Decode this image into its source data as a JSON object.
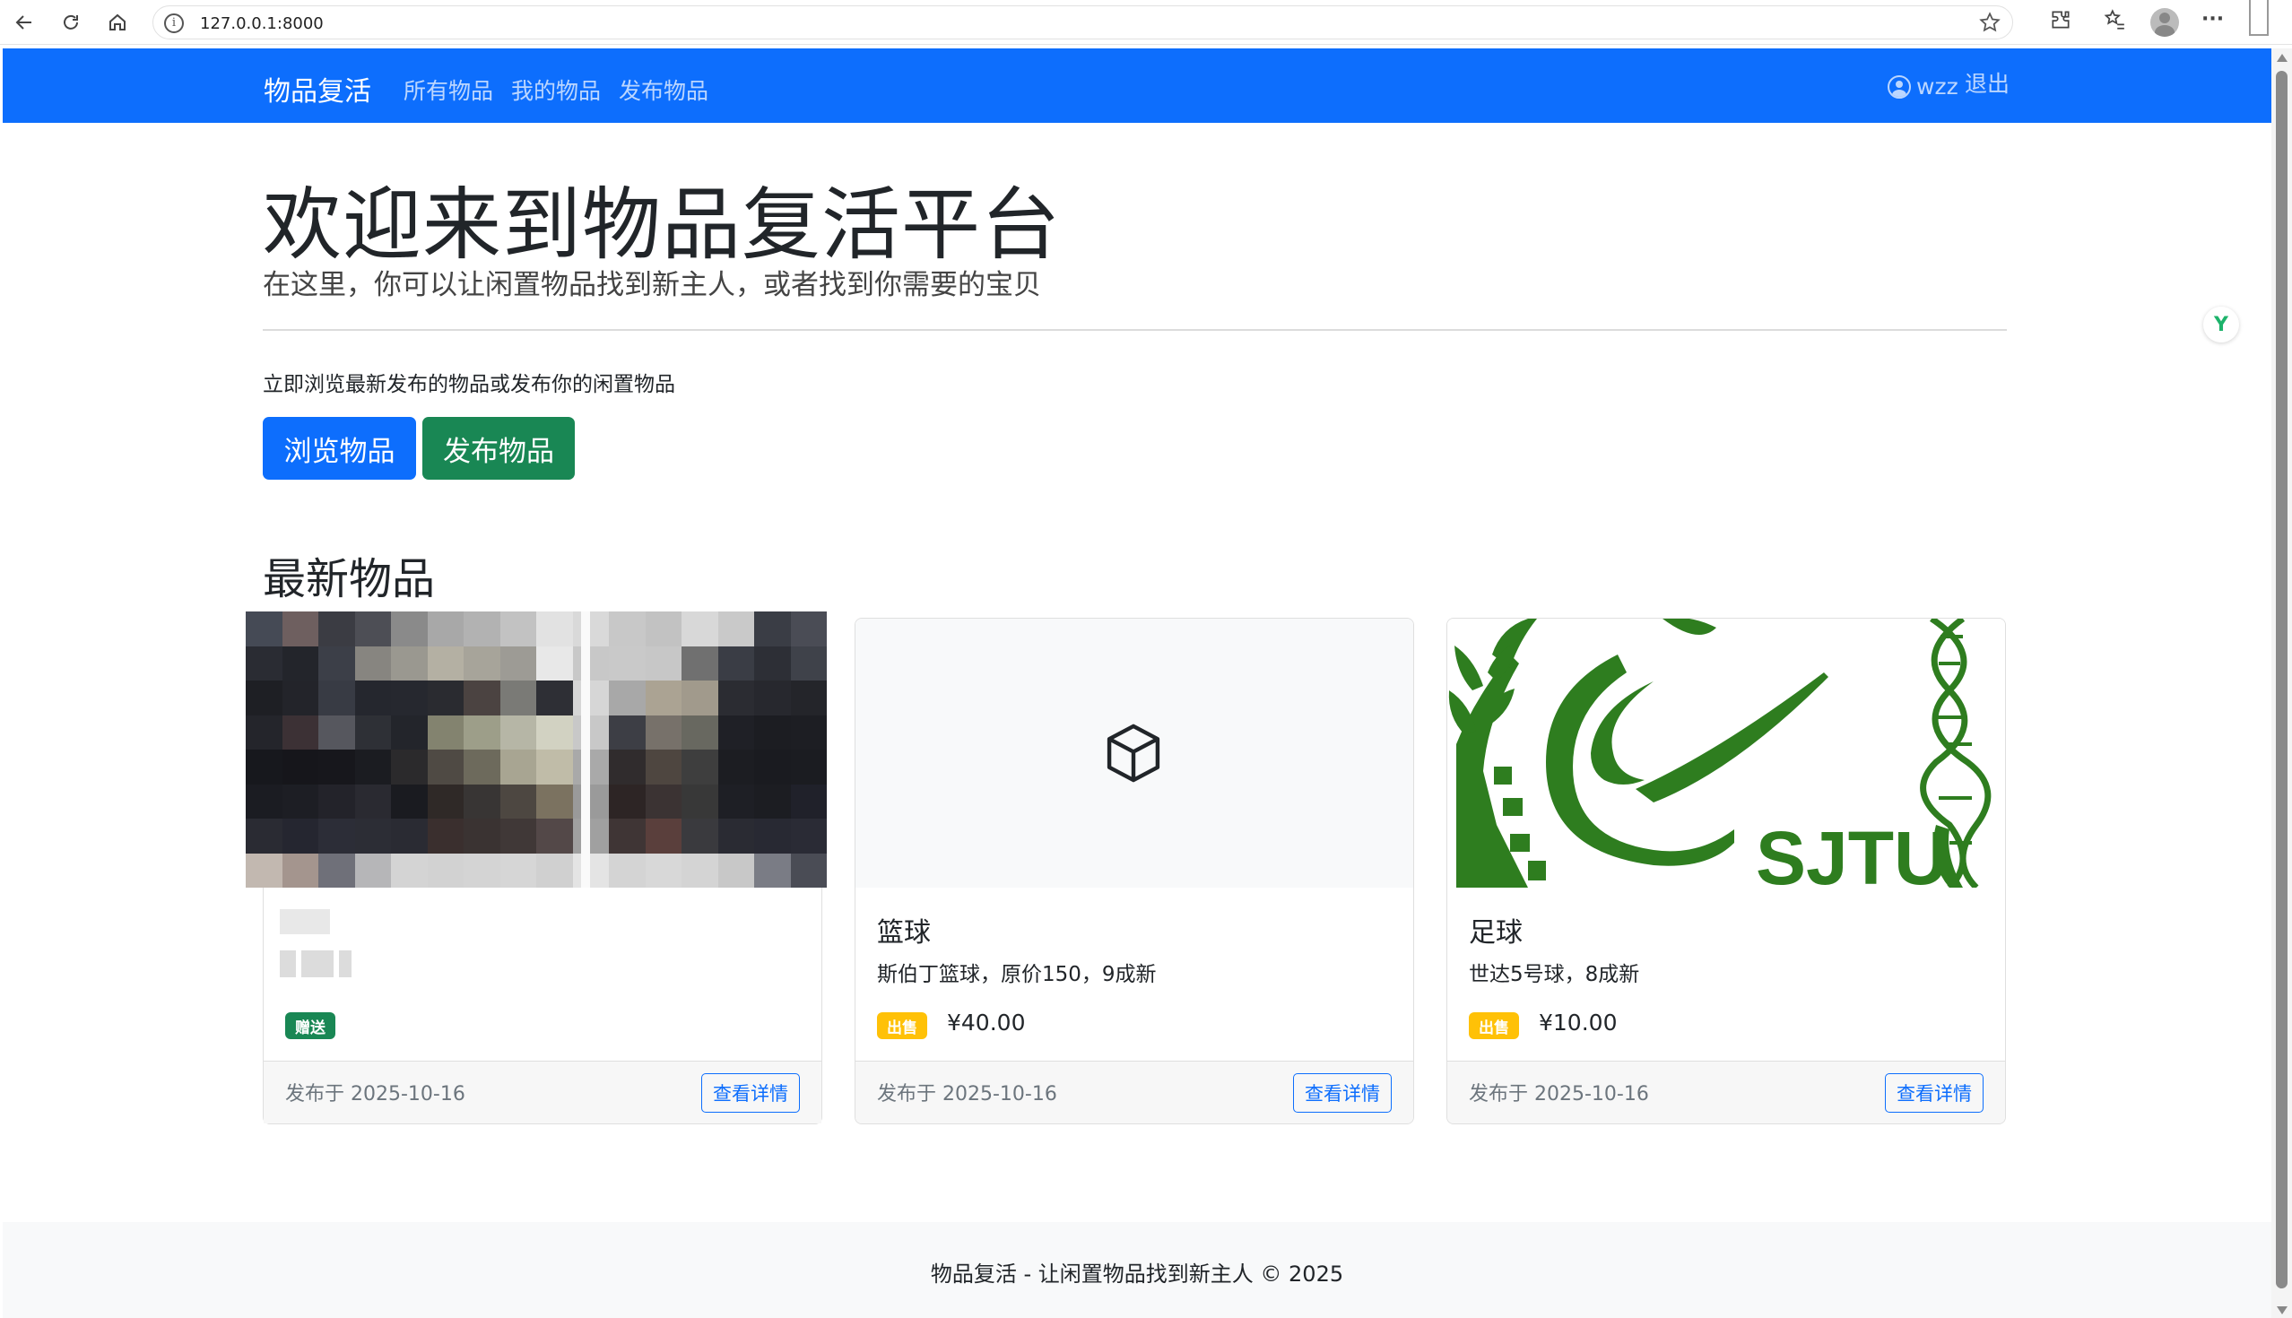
{
  "browser": {
    "url": "127.0.0.1:8000",
    "back_icon": "arrow-left-icon",
    "reload_icon": "reload-icon",
    "home_icon": "home-icon",
    "info_glyph": "i",
    "star_icon": "star-icon",
    "extensions_icon": "puzzle-icon",
    "favorites_icon": "favorites-icon",
    "menu_glyph": "···"
  },
  "navbar": {
    "brand": "物品复活",
    "links": [
      "所有物品",
      "我的物品",
      "发布物品"
    ],
    "username": "wzz",
    "logout": "退出",
    "background_color": "#0d6efd"
  },
  "hero": {
    "title": "欢迎来到物品复活平台",
    "lead": "在这里，你可以让闲置物品找到新主人，或者找到你需要的宝贝",
    "text": "立即浏览最新发布的物品或发布你的闲置物品",
    "browse_button": "浏览物品",
    "publish_button": "发布物品"
  },
  "latest": {
    "title": "最新物品",
    "items": [
      {
        "title": "",
        "description": "",
        "badge": "赠送",
        "badge_color": "#198754",
        "price": "",
        "date": "发布于 2025-10-16",
        "detail_button": "查看详情",
        "image": "pixelated-photo"
      },
      {
        "title": "篮球",
        "description": "斯伯丁篮球，原价150，9成新",
        "badge": "出售",
        "badge_color": "#ffc107",
        "price": "¥40.00",
        "date": "发布于 2025-10-16",
        "detail_button": "查看详情",
        "image": "box-icon"
      },
      {
        "title": "足球",
        "description": "世达5号球，8成新",
        "badge": "出售",
        "badge_color": "#ffc107",
        "price": "¥10.00",
        "date": "发布于 2025-10-16",
        "detail_button": "查看详情",
        "image": "sjtu-logo"
      }
    ]
  },
  "sjtu_logo_text": "SJTU",
  "side_widget_glyph": "Y",
  "footer": {
    "text": "物品复活 - 让闲置物品找到新主人 © 2025"
  }
}
